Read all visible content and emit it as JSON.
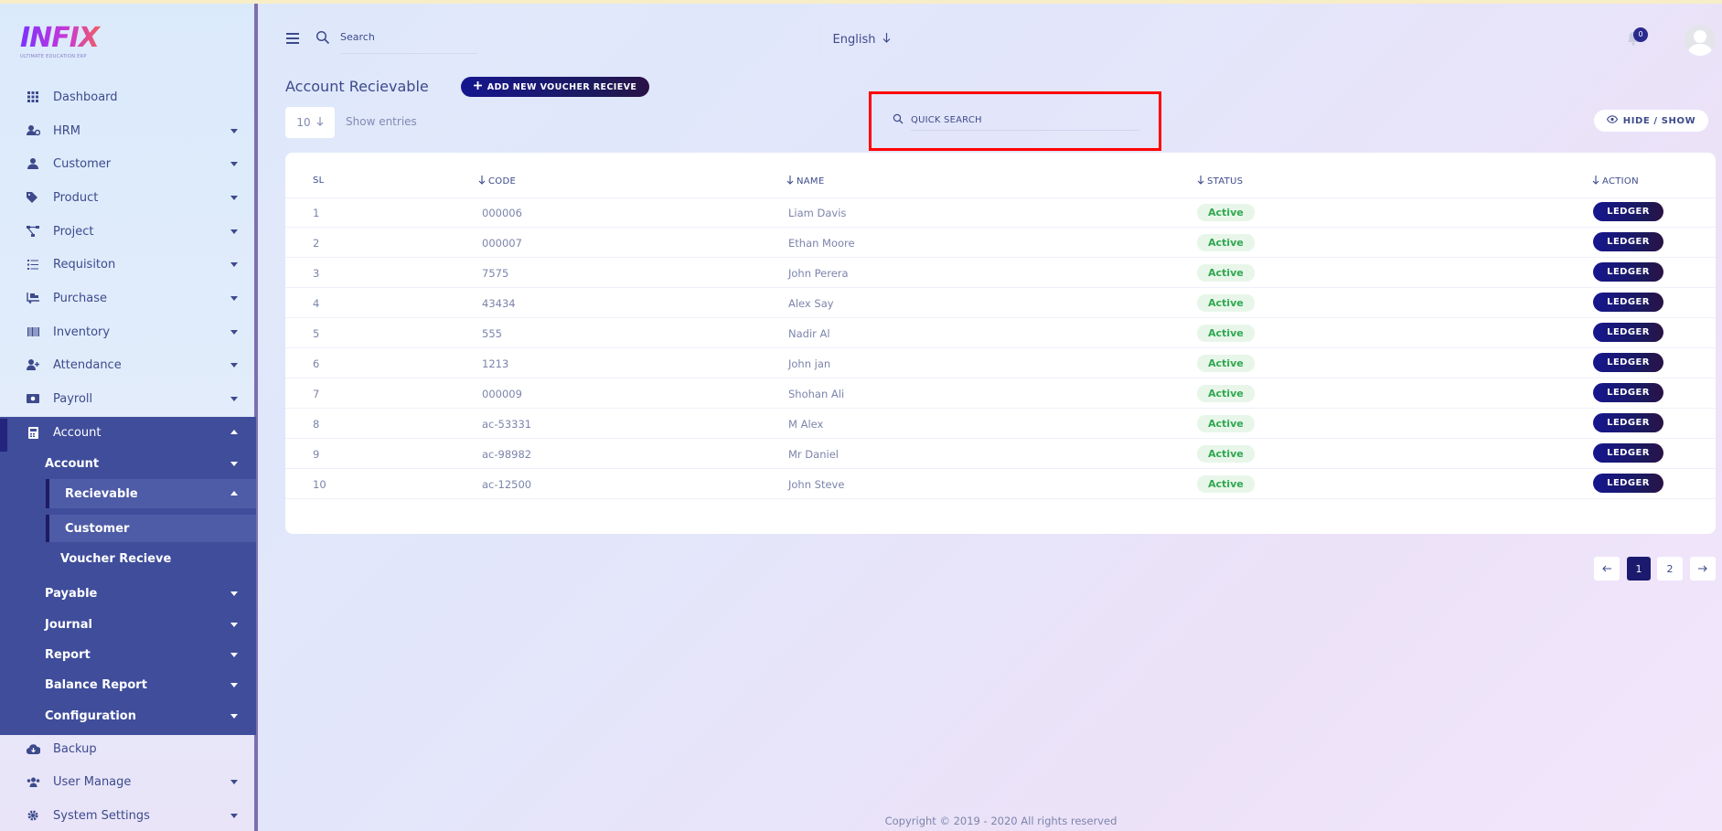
{
  "brand": {
    "name": "INFIX",
    "tagline": "ULTIMATE EDUCATION ERP"
  },
  "sidebar": {
    "items": [
      {
        "label": "Dashboard",
        "icon": "grid-icon"
      },
      {
        "label": "HRM",
        "icon": "users-cog-icon"
      },
      {
        "label": "Customer",
        "icon": "user-icon"
      },
      {
        "label": "Product",
        "icon": "tags-icon"
      },
      {
        "label": "Project",
        "icon": "project-diagram-icon"
      },
      {
        "label": "Requisiton",
        "icon": "list-icon"
      },
      {
        "label": "Purchase",
        "icon": "dolly-icon"
      },
      {
        "label": "Inventory",
        "icon": "barcode-icon"
      },
      {
        "label": "Attendance",
        "icon": "user-plus-icon"
      },
      {
        "label": "Payroll",
        "icon": "money-icon"
      },
      {
        "label": "Account",
        "icon": "calculator-icon"
      },
      {
        "label": "Backup",
        "icon": "cloud-download-icon"
      },
      {
        "label": "User Manage",
        "icon": "users-icon"
      },
      {
        "label": "System Settings",
        "icon": "gear-icon"
      }
    ],
    "account_sub": {
      "account": "Account",
      "recievable": "Recievable",
      "customer": "Customer",
      "voucher_recieve": "Voucher Recieve",
      "payable": "Payable",
      "journal": "Journal",
      "report": "Report",
      "balance_report": "Balance Report",
      "configuration": "Configuration"
    }
  },
  "header": {
    "search_label": "Search",
    "language": "English",
    "notification_count": "0"
  },
  "page": {
    "title": "Account Recievable",
    "add_button": "ADD NEW VOUCHER RECIEVE",
    "entries_value": "10",
    "show_entries": "Show entries",
    "quick_search": "QUICK SEARCH",
    "hide_show": "HIDE / SHOW"
  },
  "table": {
    "headers": {
      "sl": "SL",
      "code": "CODE",
      "name": "NAME",
      "status": "STATUS",
      "action": "ACTION"
    },
    "rows": [
      {
        "sl": "1",
        "code": "000006",
        "name": "Liam Davis",
        "status": "Active",
        "action": "LEDGER"
      },
      {
        "sl": "2",
        "code": "000007",
        "name": "Ethan Moore",
        "status": "Active",
        "action": "LEDGER"
      },
      {
        "sl": "3",
        "code": "7575",
        "name": "John Perera",
        "status": "Active",
        "action": "LEDGER"
      },
      {
        "sl": "4",
        "code": "43434",
        "name": "Alex Say",
        "status": "Active",
        "action": "LEDGER"
      },
      {
        "sl": "5",
        "code": "555",
        "name": "Nadir Al",
        "status": "Active",
        "action": "LEDGER"
      },
      {
        "sl": "6",
        "code": "1213",
        "name": "John jan",
        "status": "Active",
        "action": "LEDGER"
      },
      {
        "sl": "7",
        "code": "000009",
        "name": "Shohan Ali",
        "status": "Active",
        "action": "LEDGER"
      },
      {
        "sl": "8",
        "code": "ac-53331",
        "name": "M Alex",
        "status": "Active",
        "action": "LEDGER"
      },
      {
        "sl": "9",
        "code": "ac-98982",
        "name": "Mr Daniel",
        "status": "Active",
        "action": "LEDGER"
      },
      {
        "sl": "10",
        "code": "ac-12500",
        "name": "John Steve",
        "status": "Active",
        "action": "LEDGER"
      }
    ]
  },
  "pagination": {
    "pages": [
      "1",
      "2"
    ],
    "current": "1"
  },
  "footer": {
    "copyright": "Copyright © 2019 - 2020 All rights reserved"
  },
  "colors": {
    "accent": "#1b1a6e",
    "sidebar_active": "#3f4d9b",
    "status_active": "#2fa84f",
    "highlight": "#ff0000"
  }
}
